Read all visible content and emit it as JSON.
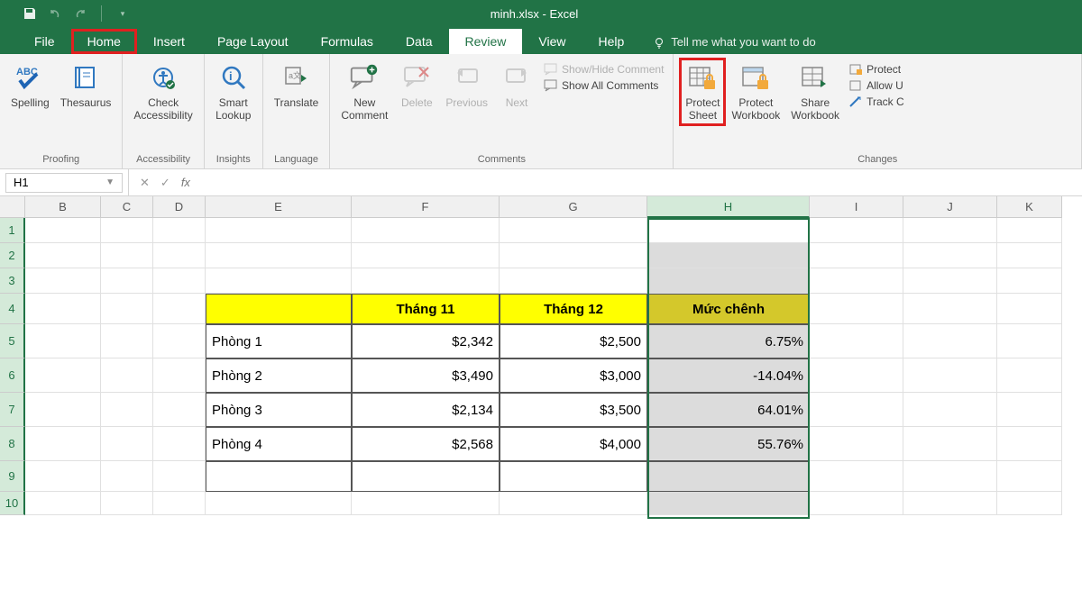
{
  "title": "minh.xlsx - Excel",
  "tabs": {
    "file": "File",
    "home": "Home",
    "insert": "Insert",
    "pagelayout": "Page Layout",
    "formulas": "Formulas",
    "data": "Data",
    "review": "Review",
    "view": "View",
    "help": "Help",
    "tellme": "Tell me what you want to do"
  },
  "ribbon": {
    "proofing": {
      "label": "Proofing",
      "spelling": "Spelling",
      "thesaurus": "Thesaurus"
    },
    "accessibility": {
      "label": "Accessibility",
      "check": "Check\nAccessibility"
    },
    "insights": {
      "label": "Insights",
      "smart": "Smart\nLookup"
    },
    "language": {
      "label": "Language",
      "translate": "Translate"
    },
    "comments": {
      "label": "Comments",
      "new": "New\nComment",
      "delete": "Delete",
      "previous": "Previous",
      "next": "Next",
      "showhide": "Show/Hide Comment",
      "showall": "Show All Comments"
    },
    "changes": {
      "label": "Changes",
      "protect_sheet": "Protect\nSheet",
      "protect_workbook": "Protect\nWorkbook",
      "share_workbook": "Share\nWorkbook",
      "protect": "Protect",
      "allow": "Allow U",
      "track": "Track C"
    }
  },
  "namebox": "H1",
  "columns": [
    "B",
    "C",
    "D",
    "E",
    "F",
    "G",
    "H",
    "I",
    "J",
    "K"
  ],
  "rows": [
    "1",
    "2",
    "3",
    "4",
    "5",
    "6",
    "7",
    "8",
    "9",
    "10"
  ],
  "table": {
    "headers": {
      "e": "",
      "f": "Tháng 11",
      "g": "Tháng 12",
      "h": "Mức chênh"
    },
    "r5": {
      "e": "Phòng 1",
      "f": "$2,342",
      "g": "$2,500",
      "h": "6.75%"
    },
    "r6": {
      "e": "Phòng 2",
      "f": "$3,490",
      "g": "$3,000",
      "h": "-14.04%"
    },
    "r7": {
      "e": "Phòng 3",
      "f": "$2,134",
      "g": "$3,500",
      "h": "64.01%"
    },
    "r8": {
      "e": "Phòng 4",
      "f": "$2,568",
      "g": "$4,000",
      "h": "55.76%"
    }
  },
  "chart_data": {
    "type": "table",
    "columns": [
      "Tháng 11",
      "Tháng 12",
      "Mức chênh"
    ],
    "rows": [
      "Phòng 1",
      "Phòng 2",
      "Phòng 3",
      "Phòng 4"
    ],
    "t11": [
      2342,
      3490,
      2134,
      2568
    ],
    "t12": [
      2500,
      3000,
      3500,
      4000
    ],
    "pct": [
      6.75,
      -14.04,
      64.01,
      55.76
    ]
  }
}
